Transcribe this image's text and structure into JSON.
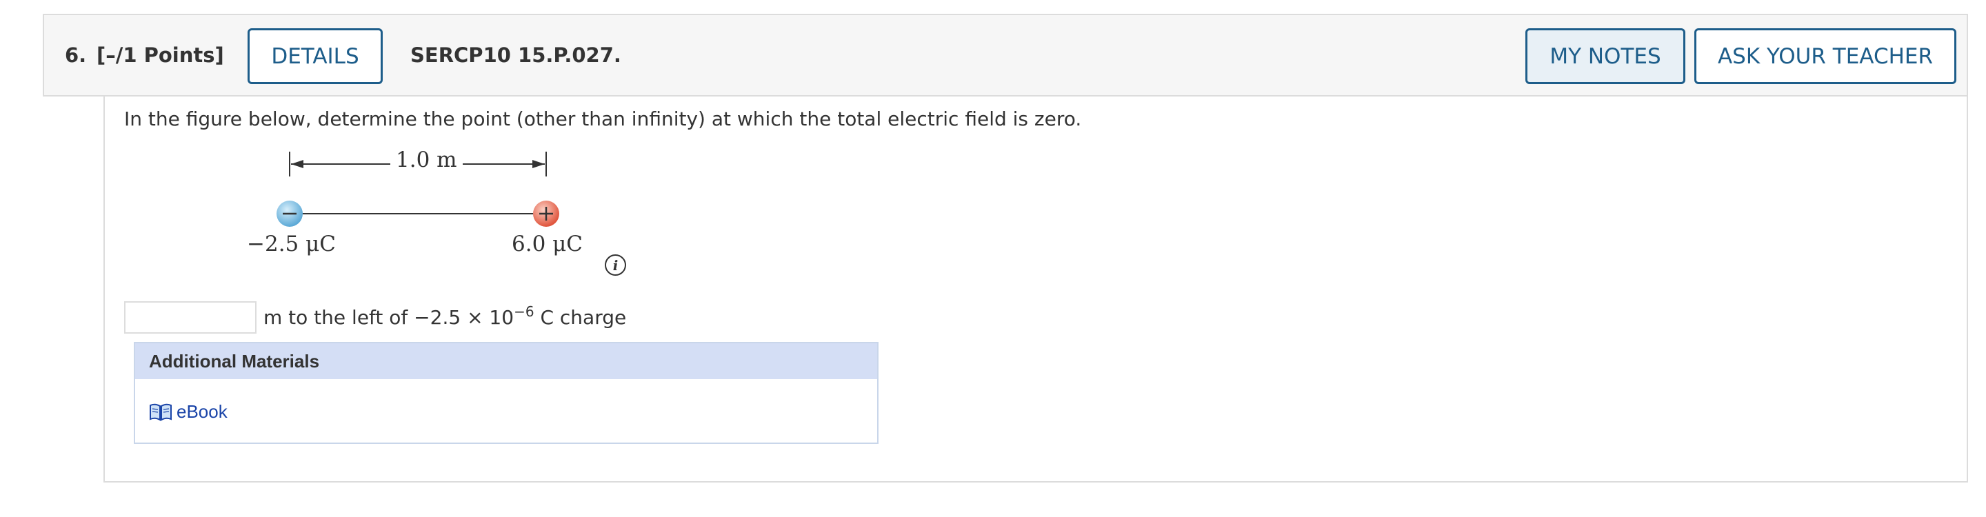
{
  "header": {
    "number": "6.",
    "points": "[–/1 Points]",
    "details_label": "DETAILS",
    "code": "SERCP10 15.P.027.",
    "notes_label": "MY NOTES",
    "teacher_label": "ASK YOUR TEACHER"
  },
  "question": {
    "prompt": "In the figure below, determine the point (other than infinity) at which the total electric field is zero.",
    "figure": {
      "distance_label": "1.0 m",
      "negative_charge_label": "−2.5 μC",
      "positive_charge_label": "6.0 μC",
      "negative_symbol": "−",
      "positive_symbol": "+"
    },
    "answer": {
      "value": "",
      "unit_text_before": "m to the left of −2.5 × 10",
      "exponent": "−6",
      "unit_text_after": " C charge"
    }
  },
  "materials": {
    "heading": "Additional Materials",
    "items": [
      {
        "label": "eBook",
        "icon": "book-icon"
      }
    ]
  },
  "colors": {
    "accent": "#1d5d8a",
    "negative_charge": "#6fb7e0",
    "positive_charge": "#e8614a",
    "materials_header": "#d4def5",
    "link": "#1a44a8"
  }
}
